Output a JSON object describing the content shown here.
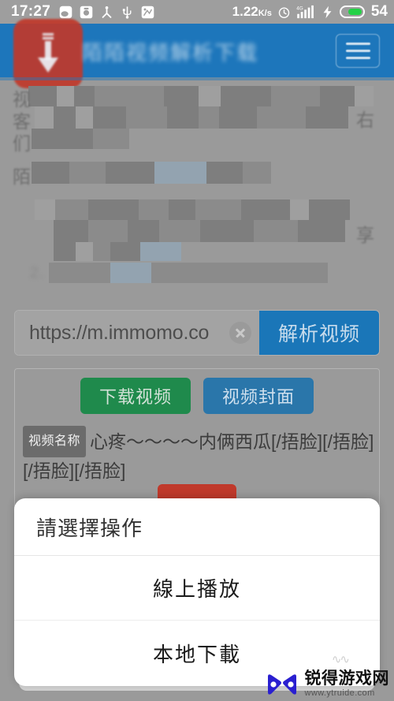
{
  "statusbar": {
    "time": "17:27",
    "left_icons": [
      "weibo-icon",
      "camera-icon",
      "person-share-icon",
      "usb-icon",
      "app-icon"
    ],
    "network_speed": "1.22",
    "network_speed_unit": "K/s",
    "alarm_icon": "alarm-clock-icon",
    "network_type": "4G",
    "signal_icon": "signal-bars-icon",
    "charging_icon": "lightning-bolt-icon",
    "battery_level": "54",
    "battery_color": "#24d146",
    "bar_background": "#9e9e9e"
  },
  "appbar": {
    "title": "陌陌视频解析下载",
    "icon_name": "download-arrow-icon",
    "icon_color": "#c0392b",
    "menu_icon": "hamburger-menu-icon",
    "background": "#1d76bb"
  },
  "body_text": {
    "edge_chars": [
      "视",
      "客",
      "们",
      "陌",
      "右",
      "享"
    ],
    "numbered_line": "2."
  },
  "url_row": {
    "value": "https://m.immomo.co",
    "clear_icon": "clear-circle-icon",
    "parse_label": "解析视频",
    "parse_color": "#1a76b8"
  },
  "result_card": {
    "download_label": "下载视频",
    "download_color": "#1f8a4c",
    "cover_label": "视频封面",
    "cover_color": "#2a76aa",
    "name_badge": "视频名称",
    "video_name": "心疼～～～～内俩西瓜[/捂脸][/捂脸][/捂脸][/捂脸]",
    "red_button_color": "#c0392b"
  },
  "dialog": {
    "title": "請選擇操作",
    "options": [
      {
        "label": "線上播放"
      },
      {
        "label": "本地下載"
      }
    ]
  },
  "watermark": {
    "name": "锐得游戏网",
    "url": "www.ytruide.com",
    "logo_name": "bowtie-logo-icon",
    "logo_color": "#2a1fd0"
  }
}
